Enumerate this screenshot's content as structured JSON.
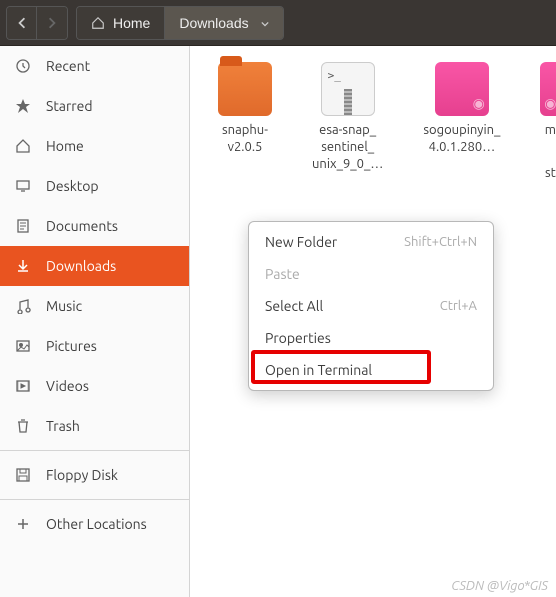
{
  "toolbar": {
    "home_label": "Home",
    "current_label": "Downloads"
  },
  "sidebar": {
    "items": [
      {
        "label": "Recent"
      },
      {
        "label": "Starred"
      },
      {
        "label": "Home"
      },
      {
        "label": "Desktop"
      },
      {
        "label": "Documents"
      },
      {
        "label": "Downloads"
      },
      {
        "label": "Music"
      },
      {
        "label": "Pictures"
      },
      {
        "label": "Videos"
      },
      {
        "label": "Trash"
      },
      {
        "label": "Floppy Disk"
      },
      {
        "label": "Other Locations"
      }
    ]
  },
  "files": [
    {
      "label": "snaphu-\nv2.0.5"
    },
    {
      "label": "esa-snap_\nsentinel_\nunix_9_0_…"
    },
    {
      "label": "sogoupinyin_\n4.0.1.280…"
    },
    {
      "label": "m"
    },
    {
      "label2": "st"
    }
  ],
  "context_menu": {
    "items": [
      {
        "label": "New Folder",
        "shortcut": "Shift+Ctrl+N"
      },
      {
        "label": "Paste"
      },
      {
        "label": "Select All",
        "shortcut": "Ctrl+A"
      },
      {
        "label": "Properties"
      },
      {
        "label": "Open in Terminal"
      }
    ]
  },
  "watermark": "CSDN @Vigo*GIS"
}
